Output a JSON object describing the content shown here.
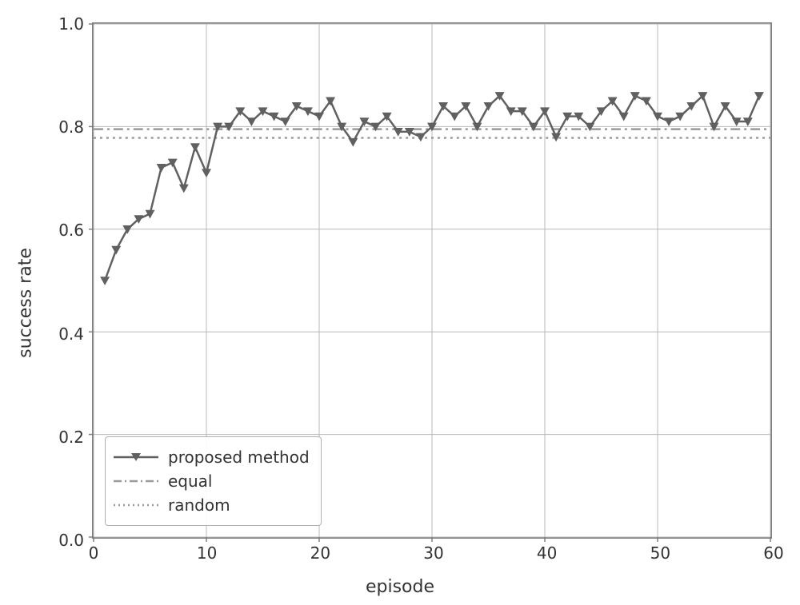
{
  "chart_data": {
    "type": "line",
    "xlabel": "episode",
    "ylabel": "success rate",
    "xlim": [
      0,
      60
    ],
    "ylim": [
      0.0,
      1.0
    ],
    "xticks": [
      0,
      10,
      20,
      30,
      40,
      50,
      60
    ],
    "yticks": [
      0.0,
      0.2,
      0.4,
      0.6,
      0.8,
      1.0
    ],
    "grid": true,
    "legend": {
      "position": "lower left",
      "entries": [
        "proposed method",
        "equal",
        "random"
      ]
    },
    "reference_lines": [
      {
        "name": "equal",
        "style": "dashdot",
        "y": 0.795,
        "color": "#9a9a9a"
      },
      {
        "name": "random",
        "style": "dotted",
        "y": 0.778,
        "color": "#9a9a9a"
      }
    ],
    "series": [
      {
        "name": "proposed method",
        "marker": "triangle-down",
        "color": "#606060",
        "x": [
          1,
          2,
          3,
          4,
          5,
          6,
          7,
          8,
          9,
          10,
          11,
          12,
          13,
          14,
          15,
          16,
          17,
          18,
          19,
          20,
          21,
          22,
          23,
          24,
          25,
          26,
          27,
          28,
          29,
          30,
          31,
          32,
          33,
          34,
          35,
          36,
          37,
          38,
          39,
          40,
          41,
          42,
          43,
          44,
          45,
          46,
          47,
          48,
          49,
          50,
          51,
          52,
          53,
          54,
          55,
          56,
          57,
          58,
          59
        ],
        "values": [
          0.5,
          0.56,
          0.6,
          0.62,
          0.63,
          0.72,
          0.73,
          0.68,
          0.76,
          0.71,
          0.8,
          0.8,
          0.83,
          0.81,
          0.83,
          0.82,
          0.81,
          0.84,
          0.83,
          0.82,
          0.85,
          0.8,
          0.77,
          0.81,
          0.8,
          0.82,
          0.79,
          0.79,
          0.78,
          0.8,
          0.84,
          0.82,
          0.84,
          0.8,
          0.84,
          0.86,
          0.83,
          0.83,
          0.8,
          0.83,
          0.78,
          0.82,
          0.82,
          0.8,
          0.83,
          0.85,
          0.82,
          0.86,
          0.85,
          0.82,
          0.81,
          0.82,
          0.84,
          0.86,
          0.8,
          0.84,
          0.81,
          0.81,
          0.86
        ]
      }
    ]
  }
}
